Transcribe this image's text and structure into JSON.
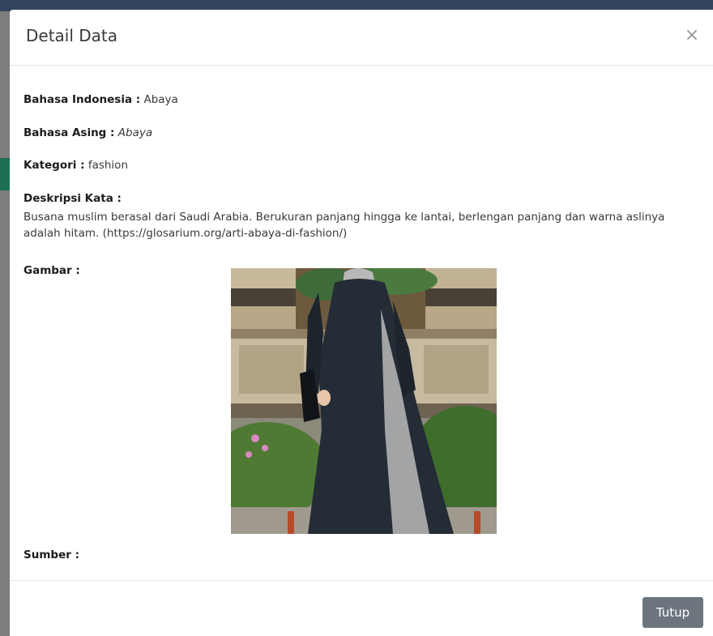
{
  "modal": {
    "title": "Detail Data",
    "close_symbol": "×"
  },
  "fields": {
    "bahasa_indonesia_label": "Bahasa Indonesia :",
    "bahasa_indonesia_value": "Abaya",
    "bahasa_asing_label": "Bahasa Asing :",
    "bahasa_asing_value": "Abaya",
    "kategori_label": "Kategori :",
    "kategori_value": "fashion",
    "deskripsi_label": "Deskripsi Kata :",
    "deskripsi_value": "Busana muslim berasal dari Saudi Arabia. Berukuran panjang hingga ke lantai, berlengan panjang dan warna aslinya adalah hitam. (https://glosarium.org/arti-abaya-di-fashion/)",
    "gambar_label": "Gambar :",
    "sumber_label": "Sumber :"
  },
  "footer": {
    "close_label": "Tutup"
  },
  "colors": {
    "button_secondary": "#6c757d",
    "border": "#e5e5e5",
    "header_bar": "#33455e"
  },
  "icons": {
    "close": "close-icon"
  }
}
